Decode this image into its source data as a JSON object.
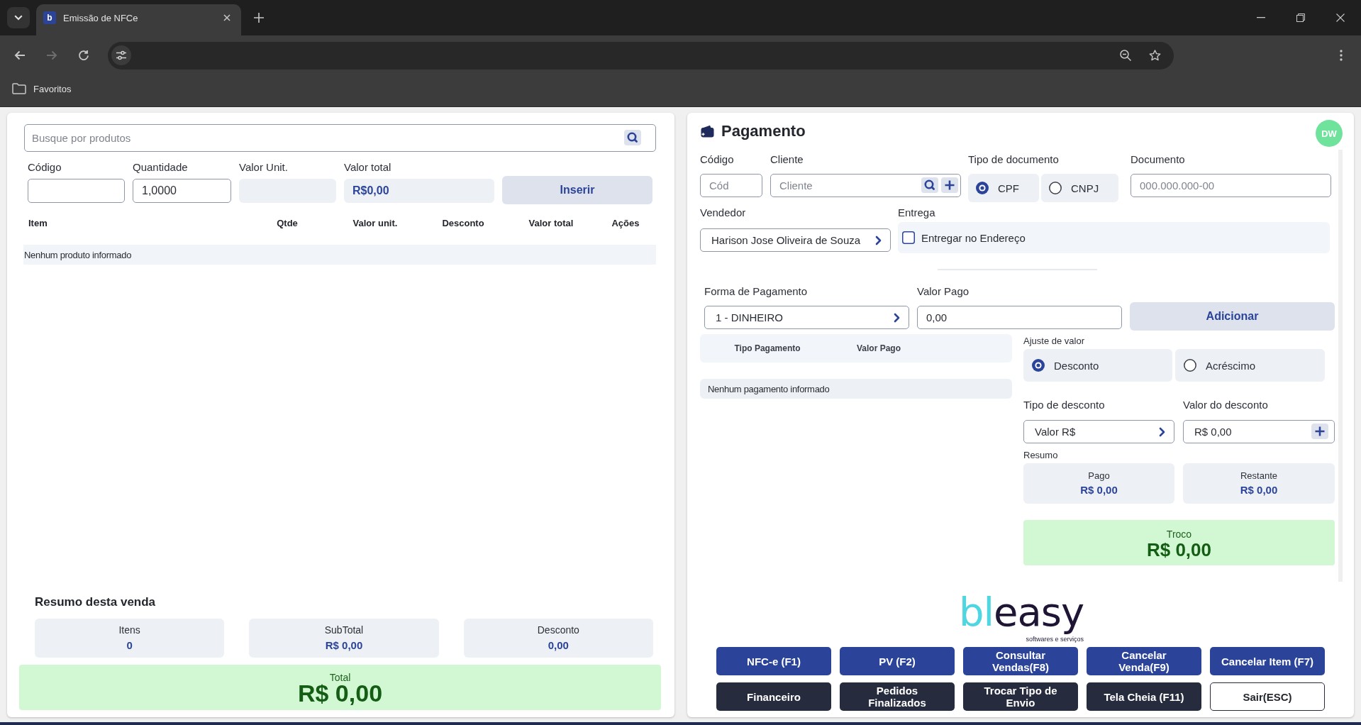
{
  "browser": {
    "tabs": [
      {
        "title": "Emissão de NFCe",
        "favicon": "b",
        "selected": true
      }
    ],
    "nav_buttons": [
      {
        "kind": "back",
        "disabled": false
      },
      {
        "kind": "forward",
        "disabled": true
      },
      {
        "kind": "reload",
        "disabled": false
      }
    ],
    "bookmarks": [
      {
        "label": "Favoritos"
      }
    ]
  },
  "products": {
    "search": {
      "placeholder": "Busque por produtos"
    },
    "fields": [
      {
        "label": "Código",
        "kind": "input"
      },
      {
        "label": "Quantidade",
        "kind": "input",
        "value": "1,0000"
      },
      {
        "label": "Valor Unit.",
        "kind": "display"
      },
      {
        "label": "Valor total",
        "kind": "display",
        "value": "R$0,00"
      }
    ],
    "insert_button": "Inserir",
    "table": {
      "columns": [
        "Item",
        "Qtde",
        "Valor unit.",
        "Desconto",
        "Valor total",
        "Ações"
      ],
      "empty_message": "Nenhum produto informado"
    }
  },
  "sale_summary": {
    "title": "Resumo desta venda",
    "cards": [
      {
        "label": "Itens",
        "value": "0"
      },
      {
        "label": "SubTotal",
        "value": "R$ 0,00"
      },
      {
        "label": "Desconto",
        "value": "0,00"
      }
    ],
    "total": {
      "label": "Total",
      "value": "R$ 0,00"
    }
  },
  "payment": {
    "title": "Pagamento",
    "avatar": "DW",
    "code": {
      "label": "Código",
      "placeholder": "Cód"
    },
    "client": {
      "label": "Cliente",
      "placeholder": "Cliente"
    },
    "document_type": {
      "label": "Tipo de documento",
      "options": [
        {
          "label": "CPF",
          "selected": true
        },
        {
          "label": "CNPJ",
          "selected": false
        }
      ]
    },
    "document": {
      "label": "Documento",
      "placeholder": "000.000.000-00"
    },
    "seller": {
      "label": "Vendedor",
      "value": "Harison Jose Oliveira de Souza"
    },
    "delivery": {
      "label": "Entrega",
      "option": "Entregar no Endereço",
      "checked": false
    },
    "payment_method": {
      "label": "Forma de Pagamento",
      "value": "1 - DINHEIRO"
    },
    "amount_paid": {
      "label": "Valor Pago",
      "value": "0,00"
    },
    "add_button": "Adicionar",
    "payments_table": {
      "columns": [
        "Tipo Pagamento",
        "Valor Pago"
      ],
      "empty_message": "Nenhum pagamento informado"
    },
    "adjustment": {
      "label": "Ajuste de valor",
      "options": [
        {
          "label": "Desconto",
          "selected": true
        },
        {
          "label": "Acréscimo",
          "selected": false
        }
      ]
    },
    "discount_type": {
      "label": "Tipo de desconto",
      "value": "Valor R$"
    },
    "discount_value": {
      "label": "Valor do desconto",
      "value": "R$ 0,00"
    },
    "summary": {
      "label": "Resumo",
      "cards": [
        {
          "label": "Pago",
          "value": "R$ 0,00"
        },
        {
          "label": "Restante",
          "value": "R$ 0,00"
        }
      ]
    },
    "change": {
      "label": "Troco",
      "value": "R$ 0,00"
    },
    "logo": {
      "wordmark": [
        {
          "text": "bl",
          "kind": "accent"
        },
        {
          "text": "easy",
          "kind": "base"
        }
      ],
      "tagline": "softwares e serviços"
    },
    "actions": [
      {
        "label": "NFC-e (F1)",
        "kind": "primary"
      },
      {
        "label": "PV (F2)",
        "kind": "primary"
      },
      {
        "label": "Consultar Vendas(F8)",
        "kind": "primary"
      },
      {
        "label": "Cancelar Venda(F9)",
        "kind": "primary"
      },
      {
        "label": "Cancelar Item (F7)",
        "kind": "primary"
      },
      {
        "label": "Financeiro",
        "kind": "dark"
      },
      {
        "label": "Pedidos Finalizados",
        "kind": "dark"
      },
      {
        "label": "Trocar Tipo de Envio",
        "kind": "dark"
      },
      {
        "label": "Tela Cheia (F11)",
        "kind": "dark"
      },
      {
        "label": "Sair(ESC)",
        "kind": "outline"
      }
    ]
  }
}
